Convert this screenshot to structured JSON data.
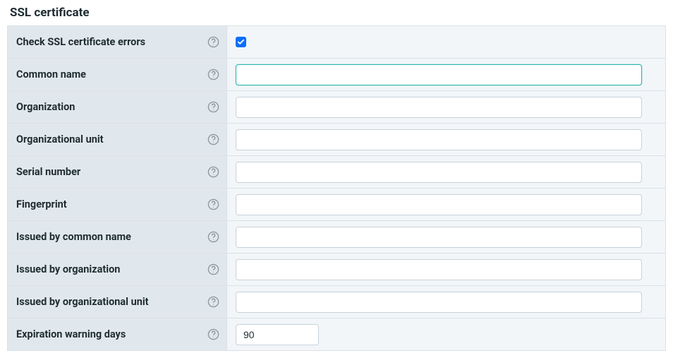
{
  "section": {
    "title": "SSL certificate"
  },
  "fields": {
    "check_errors": {
      "label": "Check SSL certificate errors",
      "checked": true
    },
    "common_name": {
      "label": "Common name",
      "value": ""
    },
    "organization": {
      "label": "Organization",
      "value": ""
    },
    "organizational_unit": {
      "label": "Organizational unit",
      "value": ""
    },
    "serial_number": {
      "label": "Serial number",
      "value": ""
    },
    "fingerprint": {
      "label": "Fingerprint",
      "value": ""
    },
    "issued_by_cn": {
      "label": "Issued by common name",
      "value": ""
    },
    "issued_by_org": {
      "label": "Issued by organization",
      "value": ""
    },
    "issued_by_ou": {
      "label": "Issued by organizational unit",
      "value": ""
    },
    "expiration_warning": {
      "label": "Expiration warning days",
      "value": "90"
    }
  }
}
